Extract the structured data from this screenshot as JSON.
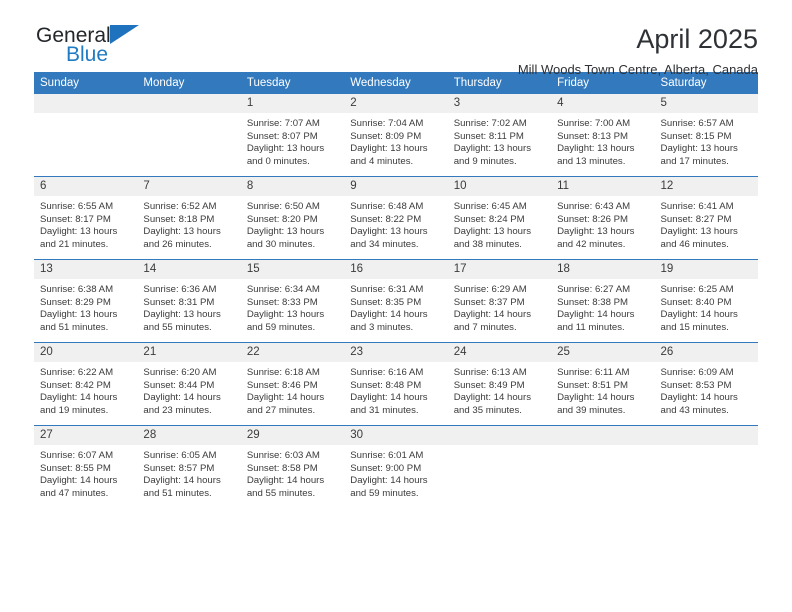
{
  "brand": {
    "name_top": "General",
    "name_bottom": "Blue",
    "triangle_color": "#1f72bd",
    "blue_text_color": "#1f7cc4"
  },
  "header": {
    "title": "April 2025",
    "subtitle": "Mill Woods Town Centre, Alberta, Canada"
  },
  "theme": {
    "header_blue": "#3279be",
    "daynum_band": "#f0f0f0",
    "text": "#3b3b3b"
  },
  "weekdays": [
    "Sunday",
    "Monday",
    "Tuesday",
    "Wednesday",
    "Thursday",
    "Friday",
    "Saturday"
  ],
  "weeks": [
    [
      {
        "day": "",
        "lines": []
      },
      {
        "day": "",
        "lines": []
      },
      {
        "day": "1",
        "lines": [
          "Sunrise: 7:07 AM",
          "Sunset: 8:07 PM",
          "Daylight: 13 hours",
          "and 0 minutes."
        ]
      },
      {
        "day": "2",
        "lines": [
          "Sunrise: 7:04 AM",
          "Sunset: 8:09 PM",
          "Daylight: 13 hours",
          "and 4 minutes."
        ]
      },
      {
        "day": "3",
        "lines": [
          "Sunrise: 7:02 AM",
          "Sunset: 8:11 PM",
          "Daylight: 13 hours",
          "and 9 minutes."
        ]
      },
      {
        "day": "4",
        "lines": [
          "Sunrise: 7:00 AM",
          "Sunset: 8:13 PM",
          "Daylight: 13 hours",
          "and 13 minutes."
        ]
      },
      {
        "day": "5",
        "lines": [
          "Sunrise: 6:57 AM",
          "Sunset: 8:15 PM",
          "Daylight: 13 hours",
          "and 17 minutes."
        ]
      }
    ],
    [
      {
        "day": "6",
        "lines": [
          "Sunrise: 6:55 AM",
          "Sunset: 8:17 PM",
          "Daylight: 13 hours",
          "and 21 minutes."
        ]
      },
      {
        "day": "7",
        "lines": [
          "Sunrise: 6:52 AM",
          "Sunset: 8:18 PM",
          "Daylight: 13 hours",
          "and 26 minutes."
        ]
      },
      {
        "day": "8",
        "lines": [
          "Sunrise: 6:50 AM",
          "Sunset: 8:20 PM",
          "Daylight: 13 hours",
          "and 30 minutes."
        ]
      },
      {
        "day": "9",
        "lines": [
          "Sunrise: 6:48 AM",
          "Sunset: 8:22 PM",
          "Daylight: 13 hours",
          "and 34 minutes."
        ]
      },
      {
        "day": "10",
        "lines": [
          "Sunrise: 6:45 AM",
          "Sunset: 8:24 PM",
          "Daylight: 13 hours",
          "and 38 minutes."
        ]
      },
      {
        "day": "11",
        "lines": [
          "Sunrise: 6:43 AM",
          "Sunset: 8:26 PM",
          "Daylight: 13 hours",
          "and 42 minutes."
        ]
      },
      {
        "day": "12",
        "lines": [
          "Sunrise: 6:41 AM",
          "Sunset: 8:27 PM",
          "Daylight: 13 hours",
          "and 46 minutes."
        ]
      }
    ],
    [
      {
        "day": "13",
        "lines": [
          "Sunrise: 6:38 AM",
          "Sunset: 8:29 PM",
          "Daylight: 13 hours",
          "and 51 minutes."
        ]
      },
      {
        "day": "14",
        "lines": [
          "Sunrise: 6:36 AM",
          "Sunset: 8:31 PM",
          "Daylight: 13 hours",
          "and 55 minutes."
        ]
      },
      {
        "day": "15",
        "lines": [
          "Sunrise: 6:34 AM",
          "Sunset: 8:33 PM",
          "Daylight: 13 hours",
          "and 59 minutes."
        ]
      },
      {
        "day": "16",
        "lines": [
          "Sunrise: 6:31 AM",
          "Sunset: 8:35 PM",
          "Daylight: 14 hours",
          "and 3 minutes."
        ]
      },
      {
        "day": "17",
        "lines": [
          "Sunrise: 6:29 AM",
          "Sunset: 8:37 PM",
          "Daylight: 14 hours",
          "and 7 minutes."
        ]
      },
      {
        "day": "18",
        "lines": [
          "Sunrise: 6:27 AM",
          "Sunset: 8:38 PM",
          "Daylight: 14 hours",
          "and 11 minutes."
        ]
      },
      {
        "day": "19",
        "lines": [
          "Sunrise: 6:25 AM",
          "Sunset: 8:40 PM",
          "Daylight: 14 hours",
          "and 15 minutes."
        ]
      }
    ],
    [
      {
        "day": "20",
        "lines": [
          "Sunrise: 6:22 AM",
          "Sunset: 8:42 PM",
          "Daylight: 14 hours",
          "and 19 minutes."
        ]
      },
      {
        "day": "21",
        "lines": [
          "Sunrise: 6:20 AM",
          "Sunset: 8:44 PM",
          "Daylight: 14 hours",
          "and 23 minutes."
        ]
      },
      {
        "day": "22",
        "lines": [
          "Sunrise: 6:18 AM",
          "Sunset: 8:46 PM",
          "Daylight: 14 hours",
          "and 27 minutes."
        ]
      },
      {
        "day": "23",
        "lines": [
          "Sunrise: 6:16 AM",
          "Sunset: 8:48 PM",
          "Daylight: 14 hours",
          "and 31 minutes."
        ]
      },
      {
        "day": "24",
        "lines": [
          "Sunrise: 6:13 AM",
          "Sunset: 8:49 PM",
          "Daylight: 14 hours",
          "and 35 minutes."
        ]
      },
      {
        "day": "25",
        "lines": [
          "Sunrise: 6:11 AM",
          "Sunset: 8:51 PM",
          "Daylight: 14 hours",
          "and 39 minutes."
        ]
      },
      {
        "day": "26",
        "lines": [
          "Sunrise: 6:09 AM",
          "Sunset: 8:53 PM",
          "Daylight: 14 hours",
          "and 43 minutes."
        ]
      }
    ],
    [
      {
        "day": "27",
        "lines": [
          "Sunrise: 6:07 AM",
          "Sunset: 8:55 PM",
          "Daylight: 14 hours",
          "and 47 minutes."
        ]
      },
      {
        "day": "28",
        "lines": [
          "Sunrise: 6:05 AM",
          "Sunset: 8:57 PM",
          "Daylight: 14 hours",
          "and 51 minutes."
        ]
      },
      {
        "day": "29",
        "lines": [
          "Sunrise: 6:03 AM",
          "Sunset: 8:58 PM",
          "Daylight: 14 hours",
          "and 55 minutes."
        ]
      },
      {
        "day": "30",
        "lines": [
          "Sunrise: 6:01 AM",
          "Sunset: 9:00 PM",
          "Daylight: 14 hours",
          "and 59 minutes."
        ]
      },
      {
        "day": "",
        "lines": []
      },
      {
        "day": "",
        "lines": []
      },
      {
        "day": "",
        "lines": []
      }
    ]
  ]
}
